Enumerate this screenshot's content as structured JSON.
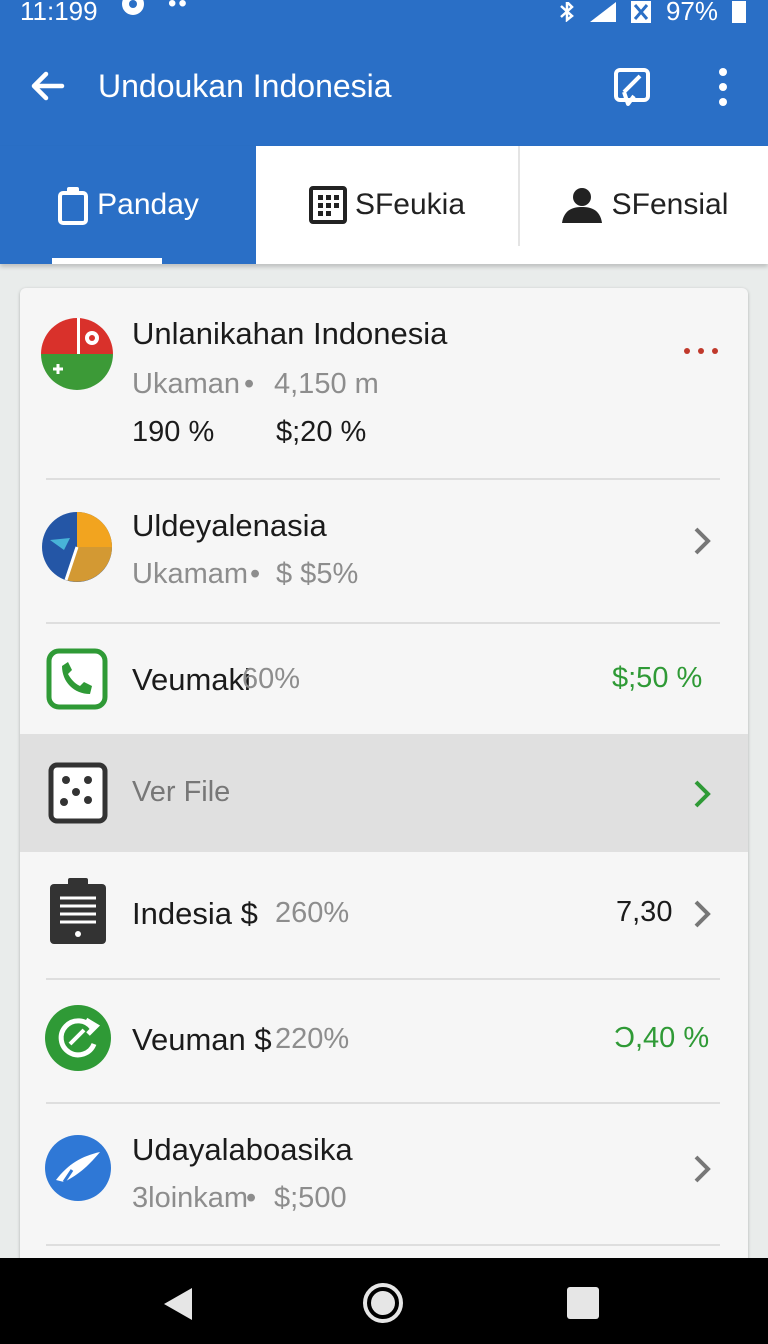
{
  "status_bar": {
    "time": "11:199",
    "battery": "97%"
  },
  "app_bar": {
    "title": "Undoukan Indonesia"
  },
  "tabs": [
    {
      "label": "Panday",
      "active": true
    },
    {
      "label": "SFeukia",
      "active": false
    },
    {
      "label": "SFensial",
      "active": false
    }
  ],
  "list": {
    "featured": {
      "title": "Unlanikahan Indonesia",
      "subtitle_a": "Ukaman",
      "subtitle_b": "4,150 m",
      "stat_a": "190 %",
      "stat_b": "$;20 %"
    },
    "item2": {
      "title": "Uldeyalenasia",
      "subtitle_a": "Ukamam",
      "subtitle_b": "$ $5%"
    },
    "item3": {
      "title": "Veumaki",
      "title_suffix": "60%",
      "value": "$;50 %"
    },
    "item4": {
      "title": "Ver File"
    },
    "item5": {
      "title": "Indesia $",
      "title_suffix": "260%",
      "value": "7,30"
    },
    "item6": {
      "title": "Veuman $",
      "title_suffix": "220%",
      "value": "Ͻ,40 %"
    },
    "item7": {
      "title": "Udayalaboasika",
      "subtitle_a": "3loinkam",
      "subtitle_b": "$;500"
    }
  },
  "colors": {
    "primary": "#2a6fc6",
    "positive": "#2f9a36",
    "selected_row": "#e0e0e0"
  }
}
